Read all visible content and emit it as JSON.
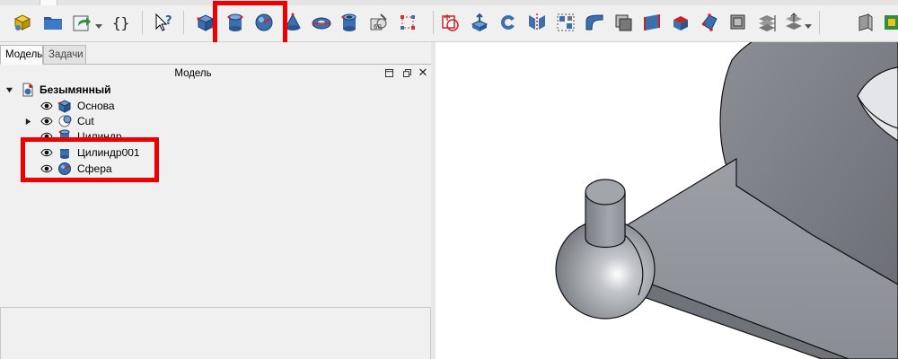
{
  "toolbar": {
    "icons": [
      "part-icon",
      "open-folder-icon",
      "macro-icon",
      "braces-icon",
      "whats-this-icon",
      "box-icon",
      "cylinder-icon",
      "sphere-icon",
      "cone-icon",
      "torus-icon",
      "tube-icon",
      "shape-builder-icon",
      "boolean-icon",
      "extrude-icon",
      "revolve-icon",
      "mirror-icon",
      "fillet-icon",
      "chamfer-icon",
      "face-icon",
      "ruled-surface-icon",
      "loft-icon",
      "sweep-icon",
      "section-icon",
      "cross-sections-icon",
      "offset-icon",
      "thickness-icon",
      "projection-icon",
      "extra-icon"
    ]
  },
  "panel": {
    "tabs": [
      {
        "label": "Модель"
      },
      {
        "label": "Задачи"
      }
    ],
    "header_title": "Модель",
    "tree": [
      {
        "label": "Безымянный"
      },
      {
        "label": "Основа"
      },
      {
        "label": "Cut"
      },
      {
        "label": "Цилиндр"
      },
      {
        "label": "Цилиндр001"
      },
      {
        "label": "Сфера"
      }
    ]
  },
  "colors": {
    "highlight": "#ee0000",
    "shape": "#8e9198",
    "primitive": "#3a6fb0"
  }
}
